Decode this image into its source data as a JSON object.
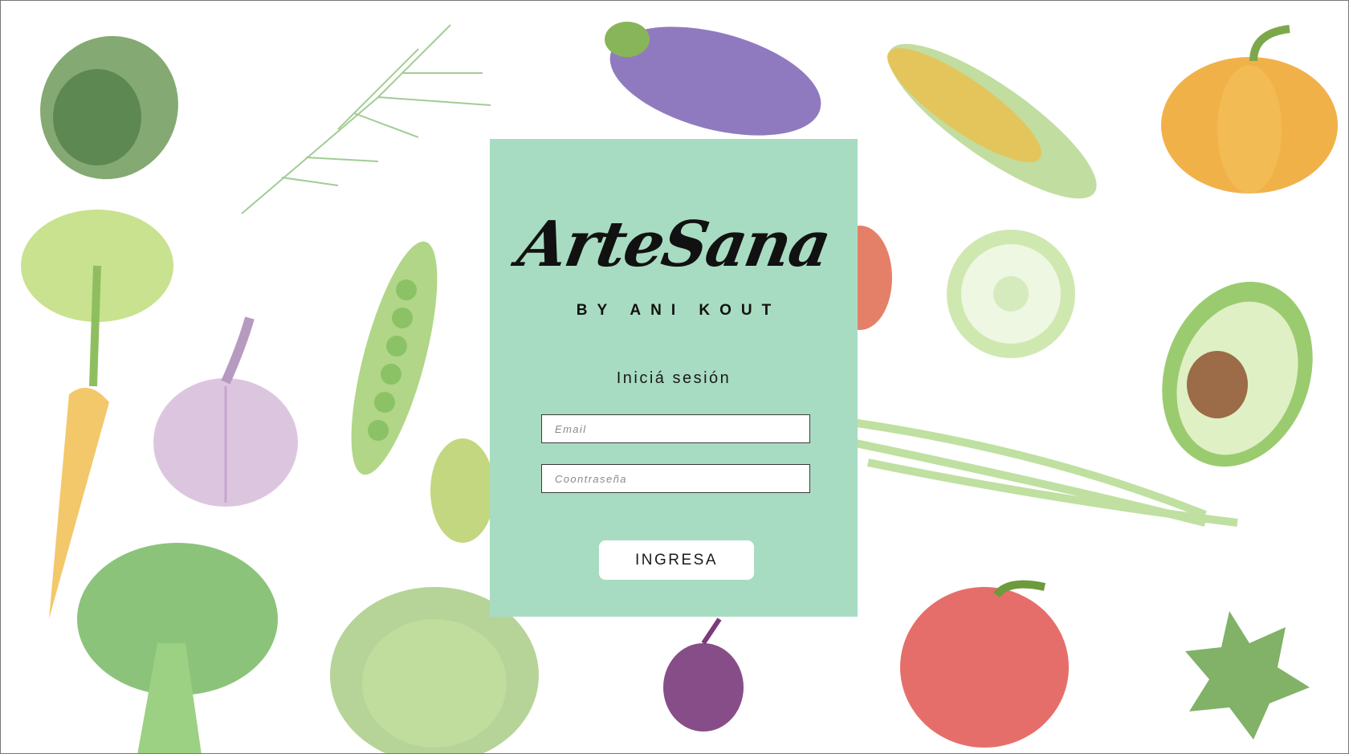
{
  "brand": {
    "logo_text": "ArteSana",
    "byline": "BY ANI KOUT"
  },
  "login": {
    "title": "Iniciá sesión",
    "email_placeholder": "Email",
    "password_placeholder": "Coontraseña",
    "submit_label": "INGRESA"
  },
  "colors": {
    "card_background": "#a8dcc2",
    "page_background": "#ffffff",
    "button_background": "#ffffff"
  },
  "background": {
    "illustrations": [
      "avocado-icon",
      "dill-icon",
      "eggplant-icon",
      "corn-icon",
      "pumpkin-icon",
      "celery-icon",
      "carrot-icon",
      "garlic-icon",
      "pea-pod-icon",
      "cucumber-slice-icon",
      "avocado-half-icon",
      "green-onion-icon",
      "broccoli-icon",
      "artichoke-icon",
      "beet-icon",
      "red-pepper-icon",
      "herb-leaf-icon",
      "tomato-icon",
      "zucchini-icon"
    ]
  }
}
